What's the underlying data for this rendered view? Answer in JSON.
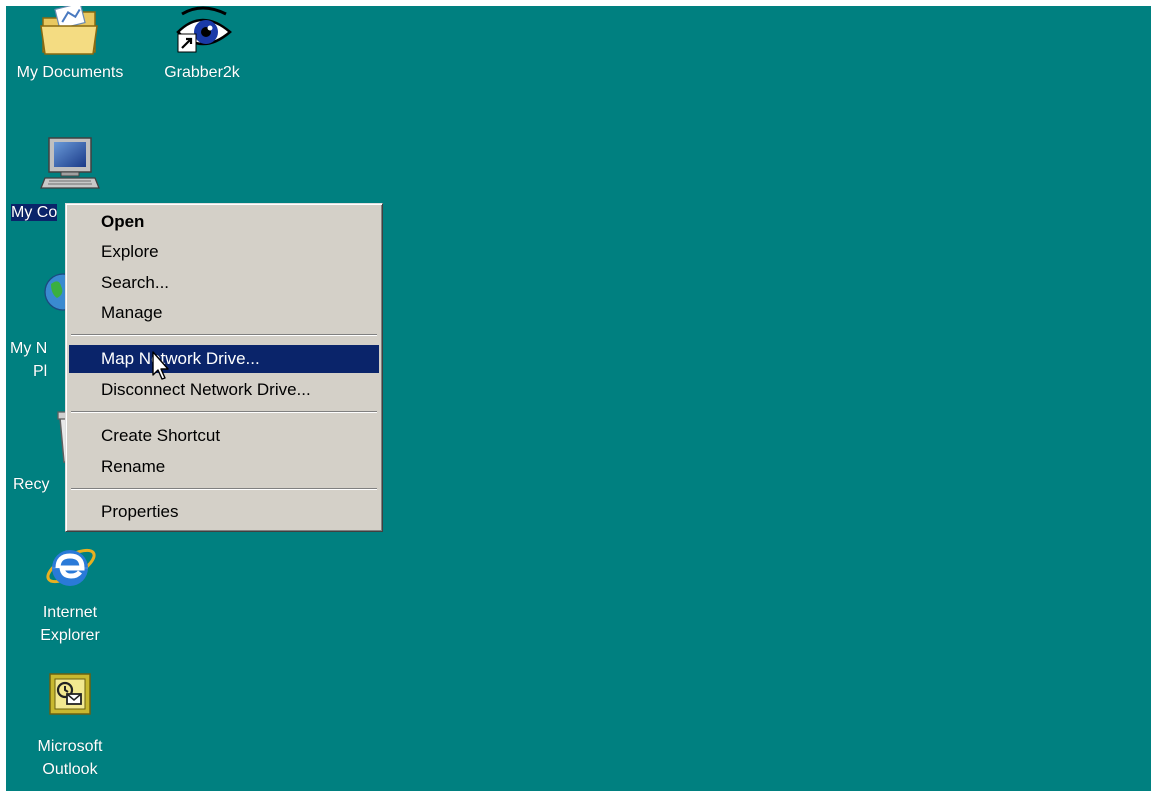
{
  "desktop": {
    "background_color": "#008080",
    "icons": [
      {
        "id": "my-documents",
        "label": "My Documents",
        "icon": "folder-documents-icon"
      },
      {
        "id": "grabber2k",
        "label": "Grabber2k",
        "icon": "eye-shortcut-icon"
      },
      {
        "id": "my-computer",
        "label": "My Co",
        "icon": "computer-icon",
        "selected": true
      },
      {
        "id": "my-network-places",
        "label_lines": [
          "My N",
          "Pl"
        ],
        "icon": "network-places-icon"
      },
      {
        "id": "recycle-bin",
        "label": "Recy",
        "icon": "recycle-bin-icon"
      },
      {
        "id": "internet-explorer",
        "label_lines": [
          "Internet",
          "Explorer"
        ],
        "icon": "internet-explorer-icon"
      },
      {
        "id": "microsoft-outlook",
        "label_lines": [
          "Microsoft",
          "Outlook"
        ],
        "icon": "outlook-icon"
      }
    ]
  },
  "context_menu": {
    "items": [
      {
        "label": "Open",
        "bold": true
      },
      {
        "label": "Explore"
      },
      {
        "label": "Search..."
      },
      {
        "label": "Manage"
      },
      {
        "label": "Map Network Drive...",
        "highlighted": true
      },
      {
        "label": "Disconnect Network Drive..."
      },
      {
        "label": "Create Shortcut"
      },
      {
        "label": "Rename"
      },
      {
        "label": "Properties"
      }
    ],
    "highlight_color": "#0a246a",
    "menu_color": "#d4d0c8"
  },
  "cursor": {
    "icon": "arrow-cursor-icon"
  }
}
